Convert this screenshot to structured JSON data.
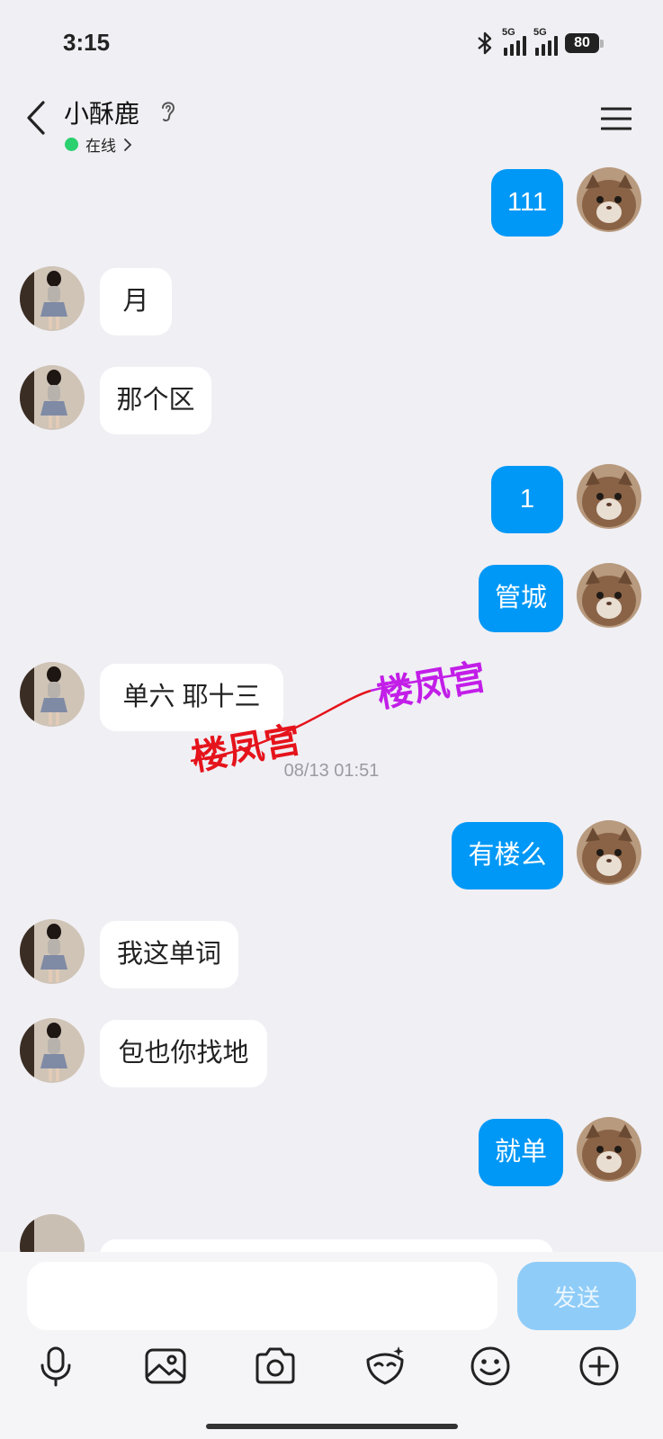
{
  "status_bar": {
    "time": "3:15",
    "network_1": "5G",
    "network_2": "5G",
    "battery": "80"
  },
  "header": {
    "contact_name": "小酥鹿",
    "status_label": "在线"
  },
  "messages": [
    {
      "side": "out",
      "text": "111"
    },
    {
      "side": "in",
      "text": "月"
    },
    {
      "side": "in",
      "text": "那个区"
    },
    {
      "side": "out",
      "text": "1"
    },
    {
      "side": "out",
      "text": "管城"
    },
    {
      "side": "in",
      "text": "单六  耶十三"
    },
    {
      "side": "out",
      "text": "有楼么"
    },
    {
      "side": "in",
      "text": "我这单词"
    },
    {
      "side": "in",
      "text": "包也你找地"
    },
    {
      "side": "out",
      "text": "就单"
    }
  ],
  "timestamp": "08/13 01:51",
  "watermarks": [
    "楼凤宫",
    "楼凤宫"
  ],
  "composer": {
    "placeholder": "",
    "send_label": "发送"
  },
  "colors": {
    "accent": "#0098f6",
    "send_disabled": "#8fccf8",
    "online": "#2bd06f",
    "background": "#f0eff4"
  },
  "toolbar_icons": [
    "microphone-icon",
    "image-icon",
    "camera-icon",
    "mask-icon",
    "emoji-icon",
    "plus-icon"
  ]
}
